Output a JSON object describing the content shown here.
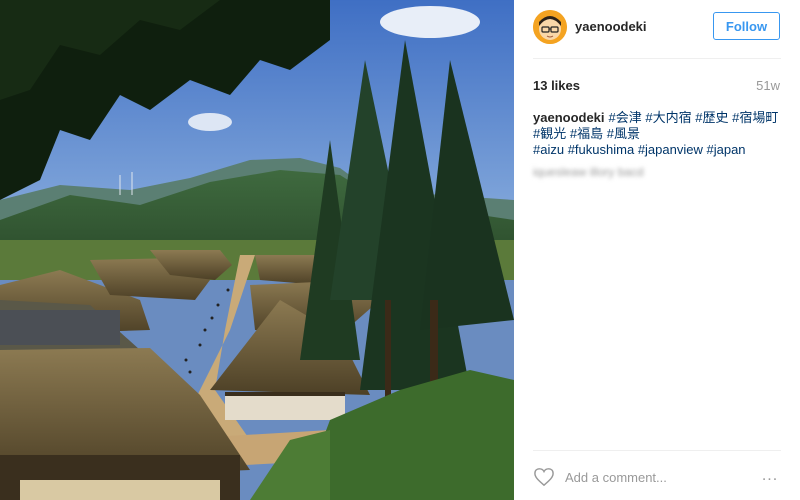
{
  "post": {
    "header": {
      "username": "yaenoodeki",
      "follow_label": "Follow"
    },
    "stats": {
      "likes": "13 likes",
      "time_ago": "51w"
    },
    "caption": {
      "username": "yaenoodeki",
      "tags_line1": [
        "#会津",
        "#大内宿",
        "#歴史",
        "#宿場町"
      ],
      "tags_line2": [
        "#観光",
        "#福島",
        "#風景"
      ],
      "tags_line3": [
        "#aizu",
        "#fukushima",
        "#japanview",
        "#japan"
      ],
      "blurred_comment": "iquesleaw illory bacd"
    },
    "comment": {
      "placeholder": "Add a comment...",
      "more_icon": "..."
    },
    "photo": {
      "subject": "thatched-roof village street with mountains and trees"
    },
    "colors": {
      "follow": "#3897f0",
      "hashtag": "#003569",
      "avatar_bg": "#f4a321"
    }
  }
}
